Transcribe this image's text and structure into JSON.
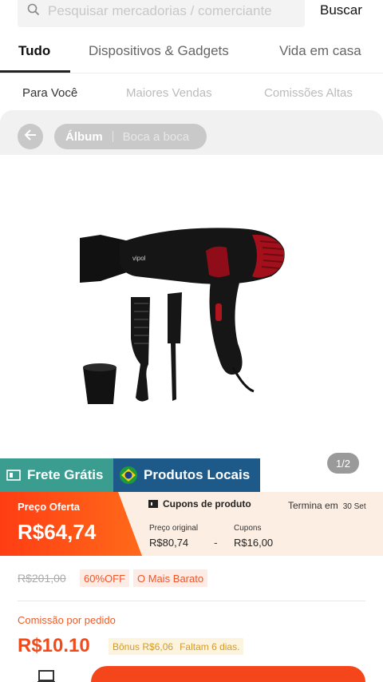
{
  "search": {
    "placeholder": "Pesquisar mercadorias / comerciante",
    "button": "Buscar"
  },
  "category_tabs": [
    {
      "label": "Tudo",
      "active": true
    },
    {
      "label": "Dispositivos & Gadgets",
      "active": false
    },
    {
      "label": "Vida em casa",
      "active": false
    }
  ],
  "sub_tabs": [
    {
      "label": "Para Você",
      "active": true
    },
    {
      "label": "Maiores Vendas",
      "active": false
    },
    {
      "label": "Comissões Altas",
      "active": false
    }
  ],
  "album_pill": {
    "primary": "Álbum",
    "secondary": "Boca a boca"
  },
  "gallery": {
    "indicator": "1/2"
  },
  "badges": {
    "frete": "Frete Grátis",
    "local": "Produtos Locais"
  },
  "price": {
    "offer_label": "Preço Oferta",
    "offer_value": "R$64,74",
    "coupon_title": "Cupons de produto",
    "ends_label": "Termina em",
    "ends_date": "30 Set",
    "original_label": "Preço original",
    "original_value": "R$80,74",
    "coupons_label": "Cupons",
    "coupons_value": "R$16,00",
    "separator": "-"
  },
  "strike_row": {
    "old_price": "R$201,00",
    "discount": "60%OFF",
    "tag": "O Mais Barato"
  },
  "commission": {
    "label": "Comissão por pedido",
    "value": "R$10.10",
    "bonus": "Bônus R$6,06",
    "remaining": "Faltam 6 dias."
  },
  "colors": {
    "accent": "#f5461b",
    "frete_badge": "#3a9d8f",
    "local_badge": "#1d5a8a"
  },
  "icons": [
    "search-icon",
    "back-arrow-icon",
    "frete-icon",
    "brazil-flag-icon",
    "coupon-icon",
    "shop-icon"
  ]
}
